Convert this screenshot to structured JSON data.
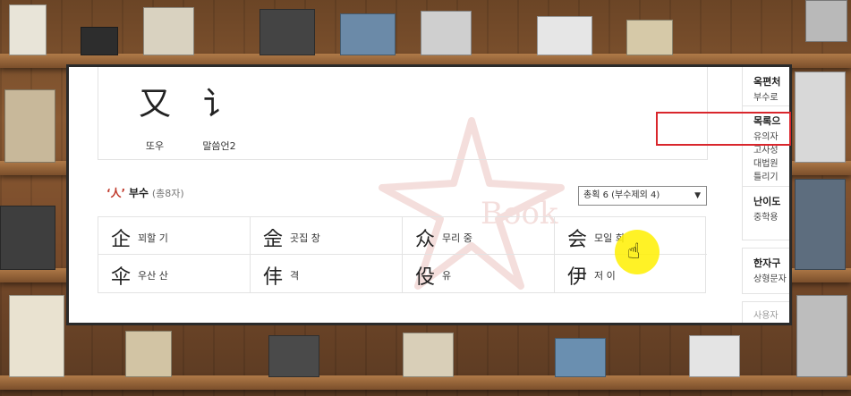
{
  "top_chars": [
    {
      "glyph": "又",
      "label": "또우"
    },
    {
      "glyph": "讠",
      "label": "말씀언2"
    }
  ],
  "radical": {
    "char_display": "‘人’",
    "name": "부수",
    "count": "(총8자)"
  },
  "stroke_filter": {
    "selected": "총획 6 (부수제외 4)",
    "arrow": "▼"
  },
  "characters": [
    {
      "glyph": "企",
      "label": "꾀할 기"
    },
    {
      "glyph": "佱",
      "label": "곳집 창"
    },
    {
      "glyph": "众",
      "label": "무리 중"
    },
    {
      "glyph": "会",
      "label": "모일 회"
    },
    {
      "glyph": "伞",
      "label": "우산 산"
    },
    {
      "glyph": "仹",
      "label": "격"
    },
    {
      "glyph": "伇",
      "label": "유"
    },
    {
      "glyph": "伊",
      "label": "저 이"
    }
  ],
  "sidebar": {
    "card1": {
      "head": "옥편처",
      "lines": [
        "부수로"
      ]
    },
    "card2": {
      "head": "목록으",
      "lines": [
        "유의자",
        "고사성",
        "대법원",
        "틀리기"
      ]
    },
    "card3": {
      "head": "난이도",
      "lines": [
        "중학용"
      ]
    },
    "card4": {
      "head": "한자구",
      "lines": [
        "상형문자"
      ]
    },
    "card5": {
      "head": "",
      "lines": [
        "사용자"
      ]
    }
  },
  "watermark_text": "Book",
  "colors": {
    "accent_red": "#d9262c",
    "radical_red": "#c0392b"
  }
}
